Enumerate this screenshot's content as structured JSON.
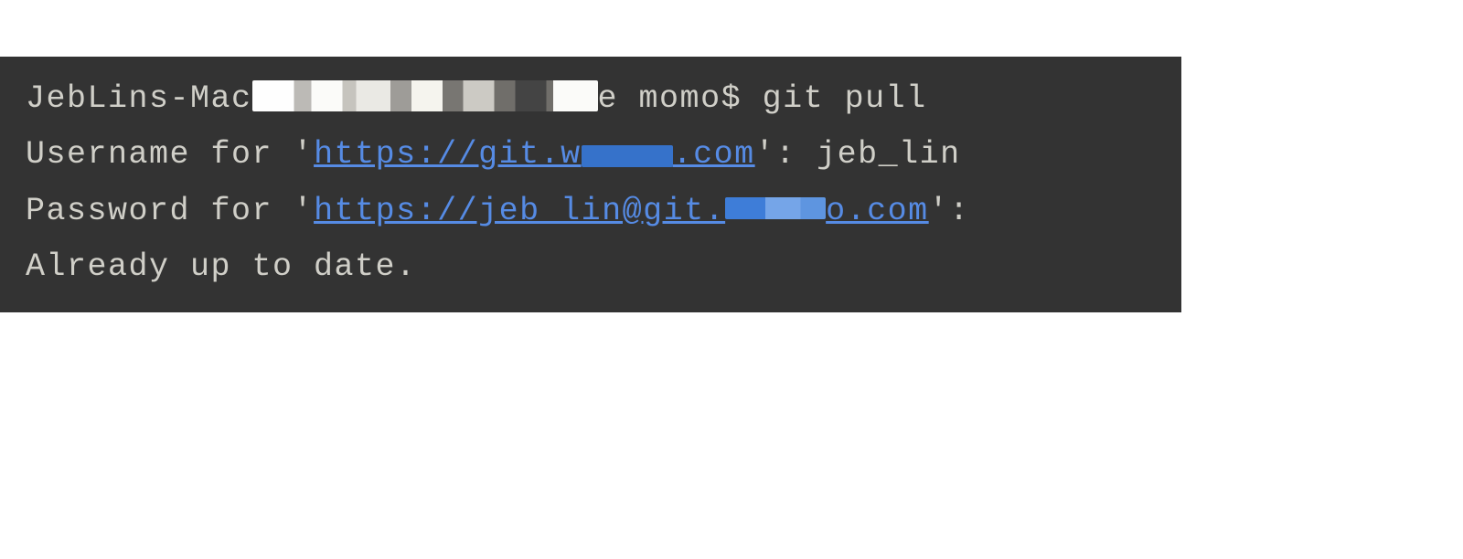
{
  "terminal": {
    "line1": {
      "prefix": "JebLins-Mac",
      "suffix": "e momo$ git pull"
    },
    "line2": {
      "label": "Username for '",
      "url_prefix": "https://git.w",
      "url_suffix": ".com",
      "after": "': jeb_lin"
    },
    "line3": {
      "label": "Password for '",
      "url_prefix": "https://jeb_lin@git.",
      "url_suffix": "o.com",
      "after": "':"
    },
    "line4": "Already up to date."
  }
}
